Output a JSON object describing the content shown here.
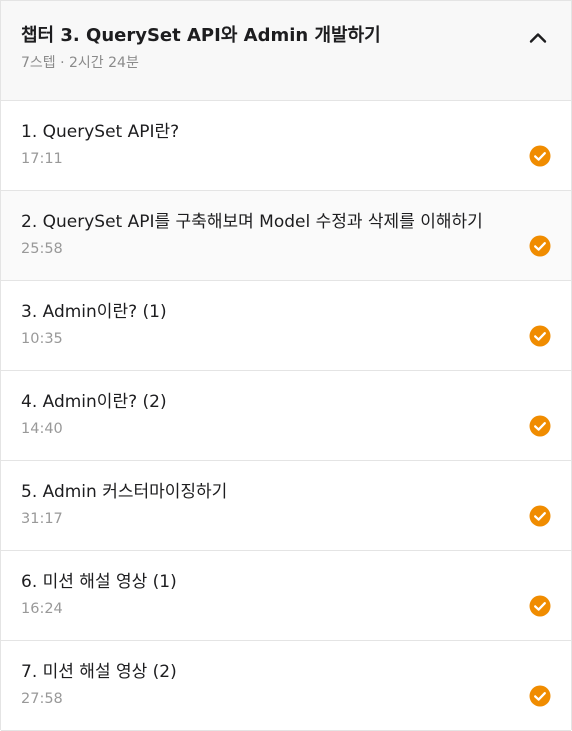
{
  "chapter": {
    "title": "챕터 3. QuerySet API와 Admin 개발하기",
    "meta": "7스텝 · 2시간 24분",
    "toggle_icon": "chevron-up-icon"
  },
  "colors": {
    "accent": "#f08c00",
    "text": "#1d1d1f",
    "muted": "#999999"
  },
  "lessons": [
    {
      "title": "1. QuerySet API란?",
      "duration": "17:11",
      "status_icon": "check-circle-icon"
    },
    {
      "title": "2. QuerySet API를 구축해보며 Model 수정과 삭제를 이해하기",
      "duration": "25:58",
      "status_icon": "check-circle-icon"
    },
    {
      "title": "3. Admin이란? (1)",
      "duration": "10:35",
      "status_icon": "check-circle-icon"
    },
    {
      "title": "4. Admin이란? (2)",
      "duration": "14:40",
      "status_icon": "check-circle-icon"
    },
    {
      "title": "5. Admin 커스터마이징하기",
      "duration": "31:17",
      "status_icon": "check-circle-icon"
    },
    {
      "title": "6. 미션 해설 영상 (1)",
      "duration": "16:24",
      "status_icon": "check-circle-icon"
    },
    {
      "title": "7. 미션 해설 영상 (2)",
      "duration": "27:58",
      "status_icon": "check-circle-icon"
    }
  ]
}
